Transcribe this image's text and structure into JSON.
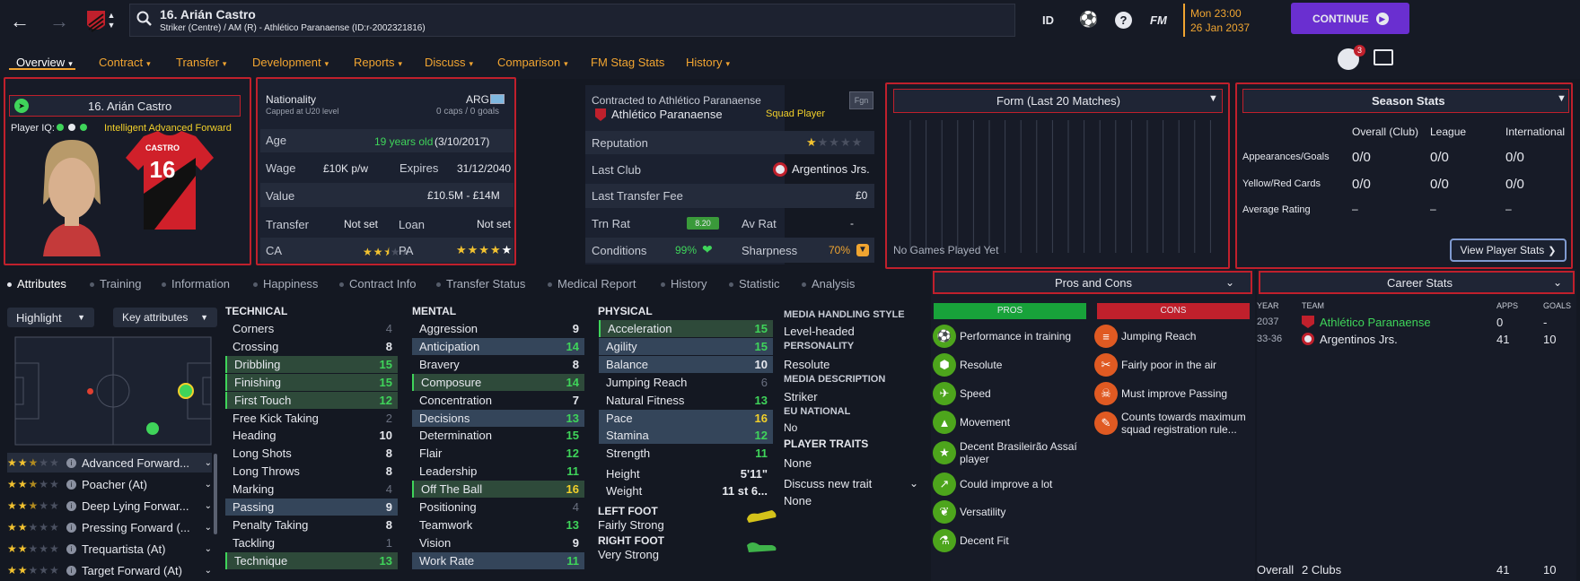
{
  "header": {
    "player_name": "16. Arián Castro",
    "subtitle": "Striker (Centre) / AM (R) - Athlético Paranaense (ID:r-2002321816)",
    "icon_id": "ID",
    "icon_fm": "FM",
    "date_line1": "Mon 23:00",
    "date_line2": "26 Jan 2037",
    "continue_label": "CONTINUE",
    "notifications_count": "3"
  },
  "nav": [
    "Overview",
    "Contract",
    "Transfer",
    "Development",
    "Reports",
    "Discuss",
    "Comparison",
    "FM Stag Stats",
    "History"
  ],
  "profile": {
    "name": "16. Arián Castro",
    "iq_label": "Player IQ:",
    "iq_text": "Intelligent  Advanced Forward",
    "shirt_name": "CASTRO",
    "shirt_number": "16"
  },
  "info": {
    "nationality_label": "Nationality",
    "nationality_value": "ARG",
    "caps_note": "Capped at U20 level",
    "caps_value": "0 caps / 0 goals",
    "age_label": "Age",
    "age_value": "19 years old",
    "dob": "(3/10/2017)",
    "wage_label": "Wage",
    "wage_value": "£10K p/w",
    "expires_label": "Expires",
    "expires_value": "31/12/2040",
    "value_label": "Value",
    "value_value": "£10.5M - £14M",
    "transfer_label": "Transfer",
    "transfer_value": "Not set",
    "loan_label": "Loan",
    "loan_value": "Not set",
    "ca_label": "CA",
    "pa_label": "PA",
    "ca_stars": 2.5,
    "pa_stars": 5
  },
  "club": {
    "contracted_label": "Contracted to Athlético Paranaense",
    "fgn_badge": "Fgn",
    "club_name": "Athlético Paranaense",
    "squad_status": "Squad Player",
    "reputation_label": "Reputation",
    "reputation_stars": 1,
    "last_club_label": "Last Club",
    "last_club_value": "Argentinos Jrs.",
    "last_fee_label": "Last Transfer Fee",
    "last_fee_value": "£0",
    "trn_rat_label": "Trn Rat",
    "trn_rat_value": "8.20",
    "av_rat_label": "Av Rat",
    "av_rat_value": "-",
    "conditions_label": "Conditions",
    "conditions_value": "99%",
    "sharpness_label": "Sharpness",
    "sharpness_value": "70%"
  },
  "form": {
    "title": "Form (Last 20 Matches)",
    "empty_text": "No Games Played Yet"
  },
  "season": {
    "title": "Season Stats",
    "columns": [
      "Overall (Club)",
      "League",
      "International"
    ],
    "rows": [
      {
        "label": "Appearances/Goals",
        "values": [
          "0/0",
          "0/0",
          "0/0"
        ]
      },
      {
        "label": "Yellow/Red Cards",
        "values": [
          "0/0",
          "0/0",
          "0/0"
        ]
      },
      {
        "label": "Average Rating",
        "values": [
          "–",
          "–",
          "–"
        ]
      }
    ],
    "view_button": "View Player Stats"
  },
  "tabs": [
    "Attributes",
    "Training",
    "Information",
    "Happiness",
    "Contract Info",
    "Transfer Status",
    "Medical Report",
    "History",
    "Statistic",
    "Analysis"
  ],
  "controls": {
    "highlight": "Highlight",
    "key_attributes": "Key attributes"
  },
  "roles": [
    {
      "label": "Advanced Forward...",
      "stars": 2.5
    },
    {
      "label": "Poacher (At)",
      "stars": 2.5
    },
    {
      "label": "Deep Lying Forwar...",
      "stars": 2.5
    },
    {
      "label": "Pressing Forward (...",
      "stars": 2
    },
    {
      "label": "Trequartista (At)",
      "stars": 2
    },
    {
      "label": "Target Forward (At)",
      "stars": 2
    }
  ],
  "technical": {
    "title": "TECHNICAL",
    "items": [
      {
        "name": "Corners",
        "value": "4"
      },
      {
        "name": "Crossing",
        "value": "8"
      },
      {
        "name": "Dribbling",
        "value": "15"
      },
      {
        "name": "Finishing",
        "value": "15"
      },
      {
        "name": "First Touch",
        "value": "12"
      },
      {
        "name": "Free Kick Taking",
        "value": "2"
      },
      {
        "name": "Heading",
        "value": "10"
      },
      {
        "name": "Long Shots",
        "value": "8"
      },
      {
        "name": "Long Throws",
        "value": "8"
      },
      {
        "name": "Marking",
        "value": "4"
      },
      {
        "name": "Passing",
        "value": "9"
      },
      {
        "name": "Penalty Taking",
        "value": "8"
      },
      {
        "name": "Tackling",
        "value": "1"
      },
      {
        "name": "Technique",
        "value": "13"
      }
    ]
  },
  "mental": {
    "title": "MENTAL",
    "items": [
      {
        "name": "Aggression",
        "value": "9"
      },
      {
        "name": "Anticipation",
        "value": "14"
      },
      {
        "name": "Bravery",
        "value": "8"
      },
      {
        "name": "Composure",
        "value": "14"
      },
      {
        "name": "Concentration",
        "value": "7"
      },
      {
        "name": "Decisions",
        "value": "13"
      },
      {
        "name": "Determination",
        "value": "15"
      },
      {
        "name": "Flair",
        "value": "12"
      },
      {
        "name": "Leadership",
        "value": "11"
      },
      {
        "name": "Off The Ball",
        "value": "16"
      },
      {
        "name": "Positioning",
        "value": "4"
      },
      {
        "name": "Teamwork",
        "value": "13"
      },
      {
        "name": "Vision",
        "value": "9"
      },
      {
        "name": "Work Rate",
        "value": "11"
      }
    ]
  },
  "physical": {
    "title": "PHYSICAL",
    "items": [
      {
        "name": "Acceleration",
        "value": "15"
      },
      {
        "name": "Agility",
        "value": "15"
      },
      {
        "name": "Balance",
        "value": "10"
      },
      {
        "name": "Jumping Reach",
        "value": "6"
      },
      {
        "name": "Natural Fitness",
        "value": "13"
      },
      {
        "name": "Pace",
        "value": "16"
      },
      {
        "name": "Stamina",
        "value": "12"
      },
      {
        "name": "Strength",
        "value": "11"
      }
    ],
    "height_label": "Height",
    "height_value": "5'11\"",
    "weight_label": "Weight",
    "weight_value": "11 st 6...",
    "left_foot_label": "LEFT FOOT",
    "left_foot_value": "Fairly Strong",
    "right_foot_label": "RIGHT FOOT",
    "right_foot_value": "Very Strong"
  },
  "media": {
    "style_label": "MEDIA HANDLING STYLE",
    "style_value": "Level-headed",
    "personality_label": "PERSONALITY",
    "personality_value": "Resolute",
    "description_label": "MEDIA DESCRIPTION",
    "description_value": "Striker",
    "eu_label": "EU NATIONAL",
    "eu_value": "No",
    "traits_label": "PLAYER TRAITS",
    "traits_value": "None",
    "discuss_label": "Discuss new trait",
    "discuss_value": "None"
  },
  "proscons": {
    "title": "Pros and Cons",
    "pros_header": "PROS",
    "cons_header": "CONS",
    "pros": [
      "Performance in training",
      "Resolute",
      "Speed",
      "Movement",
      "Decent Brasileirão Assaí player",
      "Could improve a lot",
      "Versatility",
      "Decent Fit"
    ],
    "cons": [
      "Jumping Reach",
      "Fairly poor in the air",
      "Must improve Passing",
      "Counts towards maximum squad registration rule..."
    ]
  },
  "career": {
    "title": "Career Stats",
    "columns": [
      "YEAR",
      "TEAM",
      "APPS",
      "GOALS"
    ],
    "rows": [
      {
        "year": "2037",
        "team": "Athlético Paranaense",
        "apps": "0",
        "goals": "-"
      },
      {
        "year": "33-36",
        "team": "Argentinos Jrs.",
        "apps": "41",
        "goals": "10"
      }
    ],
    "overall_label": "Overall",
    "overall_clubs": "2 Clubs",
    "overall_apps": "41",
    "overall_goals": "10"
  },
  "colors": {
    "accent_red": "#c0202c",
    "nav_active": "#f2a531",
    "green": "#3fd45a",
    "continue_bg": "#6a2fd0"
  }
}
